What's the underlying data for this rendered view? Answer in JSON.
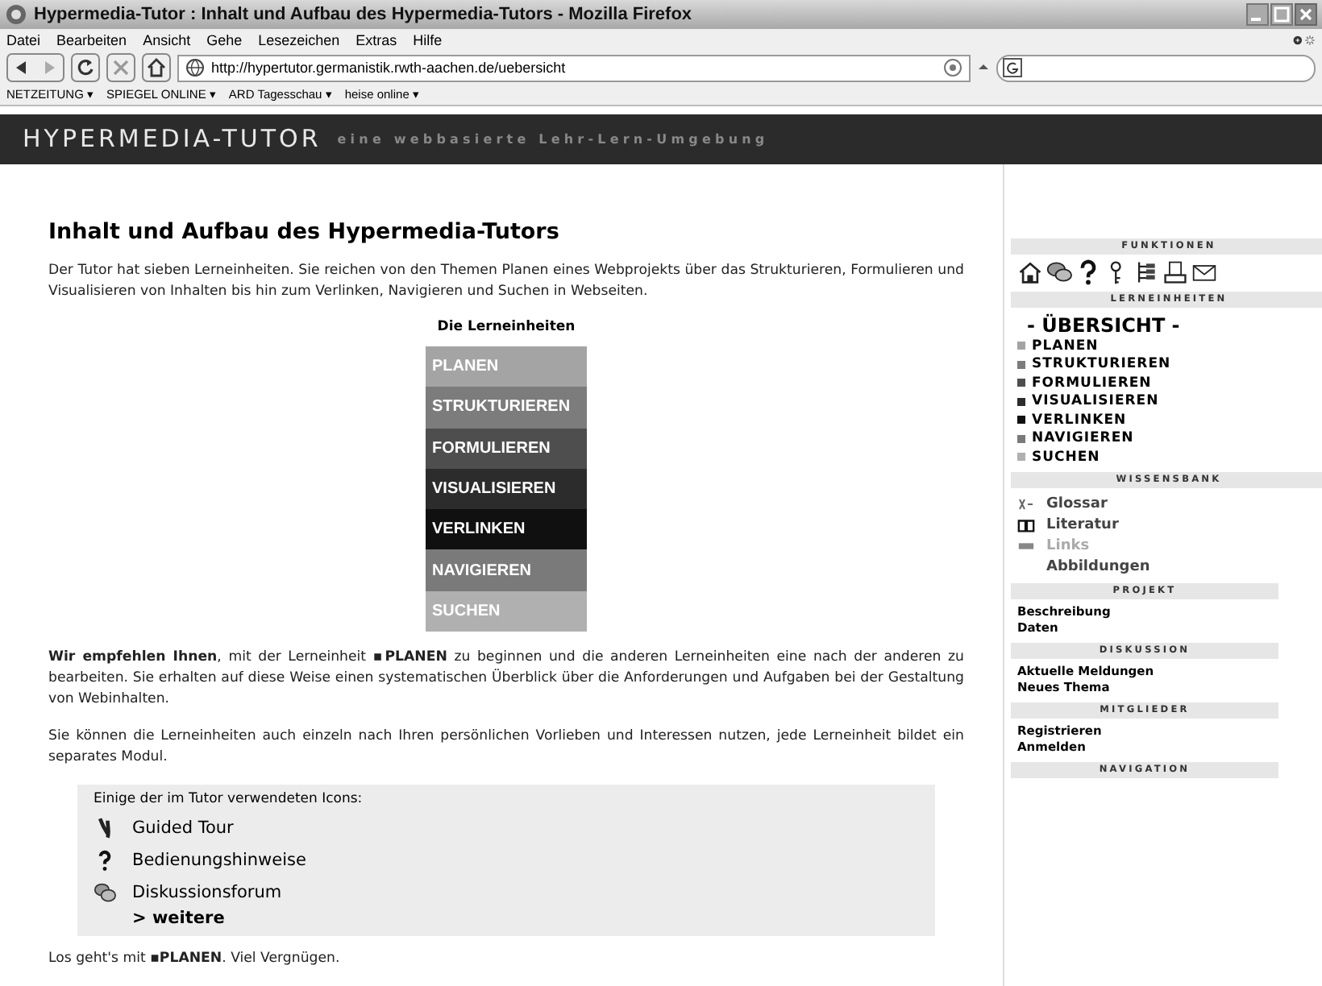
{
  "window": {
    "title": "Hypermedia-Tutor : Inhalt und Aufbau des Hypermedia-Tutors - Mozilla Firefox"
  },
  "menu": [
    "Datei",
    "Bearbeiten",
    "Ansicht",
    "Gehe",
    "Lesezeichen",
    "Extras",
    "Hilfe"
  ],
  "address_bar": {
    "value": "http://hypertutor.germanistik.rwth-aachen.de/uebersicht"
  },
  "bookmarks": [
    "NETZEITUNG ▾",
    "SPIEGEL ONLINE ▾",
    "ARD Tagesschau ▾",
    "heise online ▾"
  ],
  "site_header": {
    "title": "HYPERMEDIA-TUTOR",
    "subtitle": "eine webbasierte Lehr-Lern-Umgebung"
  },
  "main": {
    "heading": "Inhalt und Aufbau des Hypermedia-Tutors",
    "intro": "Der Tutor hat sieben Lerneinheiten. Sie reichen von den Themen Planen eines Webprojekts über das Strukturieren, Formulieren und Visualisieren von Inhalten bis hin zum Verlinken, Navigieren und Suchen in Webseiten.",
    "units_caption": "Die Lerneinheiten",
    "units": [
      {
        "label": "PLANEN",
        "color": "#a4a4a4"
      },
      {
        "label": "STRUKTURIEREN",
        "color": "#7c7c7c"
      },
      {
        "label": "FORMULIEREN",
        "color": "#4e4e4e"
      },
      {
        "label": "VISUALISIEREN",
        "color": "#2c2c2c"
      },
      {
        "label": "VERLINKEN",
        "color": "#101010"
      },
      {
        "label": "NAVIGIEREN",
        "color": "#7a7a7a"
      },
      {
        "label": "SUCHEN",
        "color": "#b0b0b0"
      }
    ],
    "paragraphs": [
      "**Wir empfehlen Ihnen**, mit der Lerneinheit ▪**PLANEN** zu beginnen und die anderen Lerneinheiten eine nach der anderen zu bearbeiten. Sie erhalten auf diese Weise einen systematischen Überblick über die Anforderungen und Aufgaben bei der Gestaltung von Webinhalten.",
      "Sie können die Lerneinheiten auch einzeln nach Ihren persönlichen Vorlieben und Interessen nutzen, jede Lerneinheit bildet ein separates Modul."
    ],
    "icons_box": {
      "title": "Einige der im Tutor verwendeten Icons:",
      "items": [
        {
          "kind": "tour",
          "label": "Guided Tour"
        },
        {
          "kind": "help",
          "label": "Bedienungshinweise"
        },
        {
          "kind": "forum",
          "label": "Diskussionsforum"
        }
      ],
      "more": "> weitere"
    },
    "closing": "Los geht's mit ▪**PLANEN**. Viel Vergnügen."
  },
  "sidebar": {
    "functions": {
      "title": "FUNKTIONEN"
    },
    "units_nav": {
      "title": "LERNEINHEITEN",
      "current": "- ÜBERSICHT -",
      "items": [
        {
          "label": "PLANEN",
          "color": "#a4a4a4"
        },
        {
          "label": "STRUKTURIEREN",
          "color": "#7c7c7c"
        },
        {
          "label": "FORMULIEREN",
          "color": "#4e4e4e"
        },
        {
          "label": "VISUALISIEREN",
          "color": "#2c2c2c"
        },
        {
          "label": "VERLINKEN",
          "color": "#101010"
        },
        {
          "label": "NAVIGIEREN",
          "color": "#7a7a7a"
        },
        {
          "label": "SUCHEN",
          "color": "#b0b0b0"
        }
      ]
    },
    "knowledge": {
      "title": "WISSENSBANK",
      "items": [
        {
          "kind": "glossary",
          "label": "Glossar",
          "disabled": false
        },
        {
          "kind": "book",
          "label": "Literatur",
          "disabled": false
        },
        {
          "kind": "links",
          "label": "Links",
          "disabled": true
        },
        {
          "kind": "plain",
          "label": "Abbildungen",
          "disabled": false
        }
      ]
    },
    "link_sections": [
      {
        "title": "PROJEKT",
        "links": [
          "Beschreibung",
          "Daten"
        ]
      },
      {
        "title": "DISKUSSION",
        "links": [
          "Aktuelle Meldungen",
          "Neues Thema"
        ]
      },
      {
        "title": "MITGLIEDER",
        "links": [
          "Registrieren",
          "Anmelden"
        ]
      },
      {
        "title": "NAVIGATION"
      }
    ]
  }
}
